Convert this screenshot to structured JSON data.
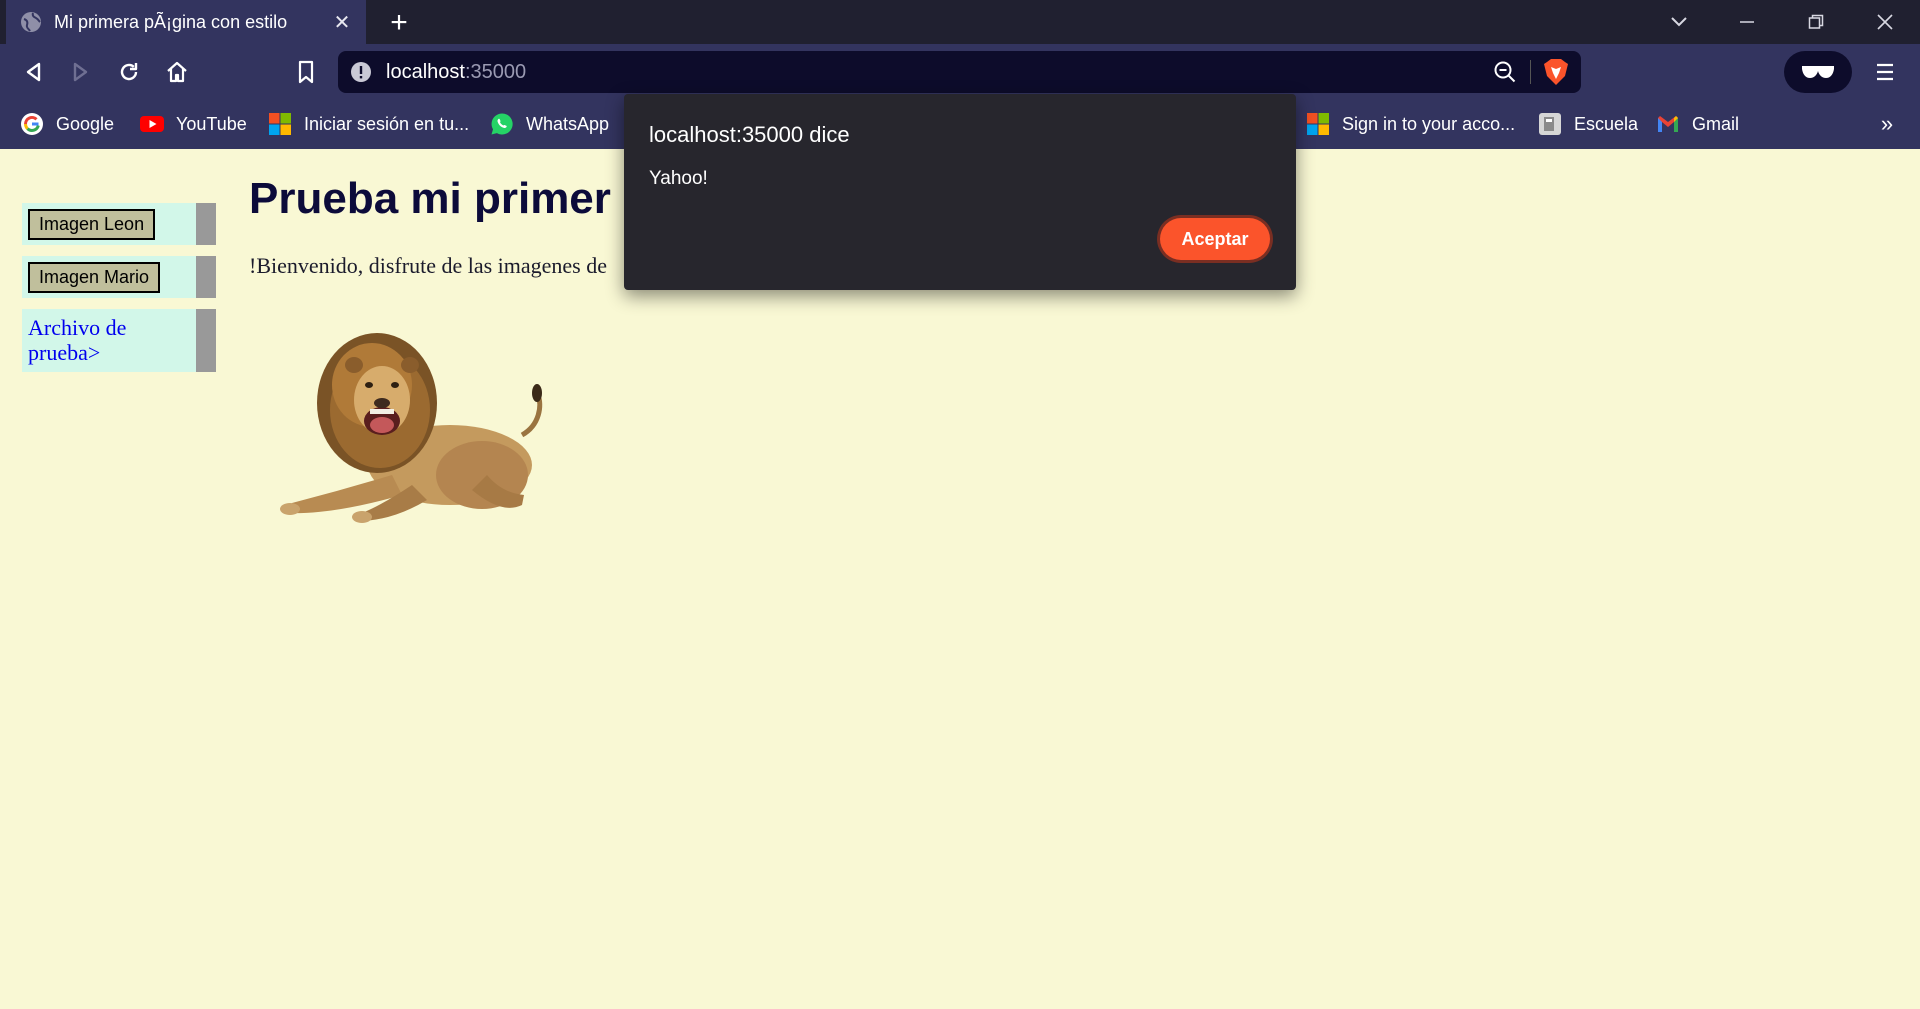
{
  "browser": {
    "tab_title": "Mi primera pÃ¡gina con estilo",
    "new_tab_label": "+",
    "url_host": "localhost",
    "url_port": ":35000",
    "bookmarks": [
      {
        "label": "Google",
        "icon": "google-icon"
      },
      {
        "label": "YouTube",
        "icon": "youtube-icon"
      },
      {
        "label": "Iniciar sesión en tu...",
        "icon": "microsoft-icon"
      },
      {
        "label": "WhatsApp",
        "icon": "whatsapp-icon"
      },
      {
        "label": "Sign in to your acco...",
        "icon": "microsoft-icon"
      },
      {
        "label": "Escuela",
        "icon": "escuela-icon"
      },
      {
        "label": "Gmail",
        "icon": "gmail-icon"
      }
    ],
    "bookmarks_more": "»",
    "accent_color": "#fb542b"
  },
  "page": {
    "sidebar": {
      "button_leon": "Imagen Leon",
      "button_mario": "Imagen Mario",
      "link_archivo": "Archivo de prueba>"
    },
    "heading": "Prueba mi primer s",
    "welcome": "!Bienvenido, disfrute de las imagenes de"
  },
  "dialog": {
    "title": "localhost:35000 dice",
    "message": "Yahoo!",
    "button": "Aceptar"
  }
}
